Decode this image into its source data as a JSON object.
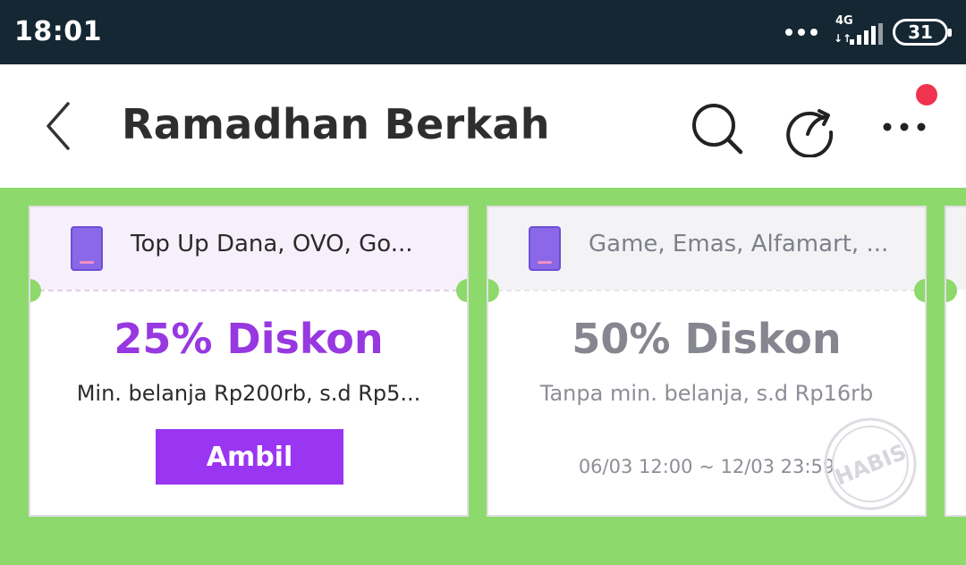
{
  "status_bar": {
    "time": "18:01",
    "network_type": "4G",
    "network_arrows": "↓↑",
    "battery": "31",
    "icons": [
      "more-dots-icon",
      "signal-icon",
      "battery-icon"
    ]
  },
  "header": {
    "title": "Ramadhan Berkah",
    "icons": [
      "back-icon",
      "search-icon",
      "share-icon",
      "more-icon"
    ],
    "notification_color": "#f0334f"
  },
  "colors": {
    "background_green": "#8ed96c",
    "accent_purple": "#9738e0",
    "button_purple": "#9a35f2",
    "disabled_gray": "#85868f"
  },
  "vouchers": [
    {
      "category": "Top Up Dana, OVO, Go...",
      "discount": "25% Diskon",
      "terms": "Min. belanja Rp200rb, s.d Rp5...",
      "button_label": "Ambil",
      "icon": "phone-icon"
    },
    {
      "category": "Game, Emas, Alfamart, ...",
      "discount": "50% Diskon",
      "terms": "Tanpa min. belanja, s.d Rp16rb",
      "period": "06/03 12:00 ~ 12/03 23:59",
      "stamp": "HABIS",
      "icon": "phone-icon"
    }
  ]
}
